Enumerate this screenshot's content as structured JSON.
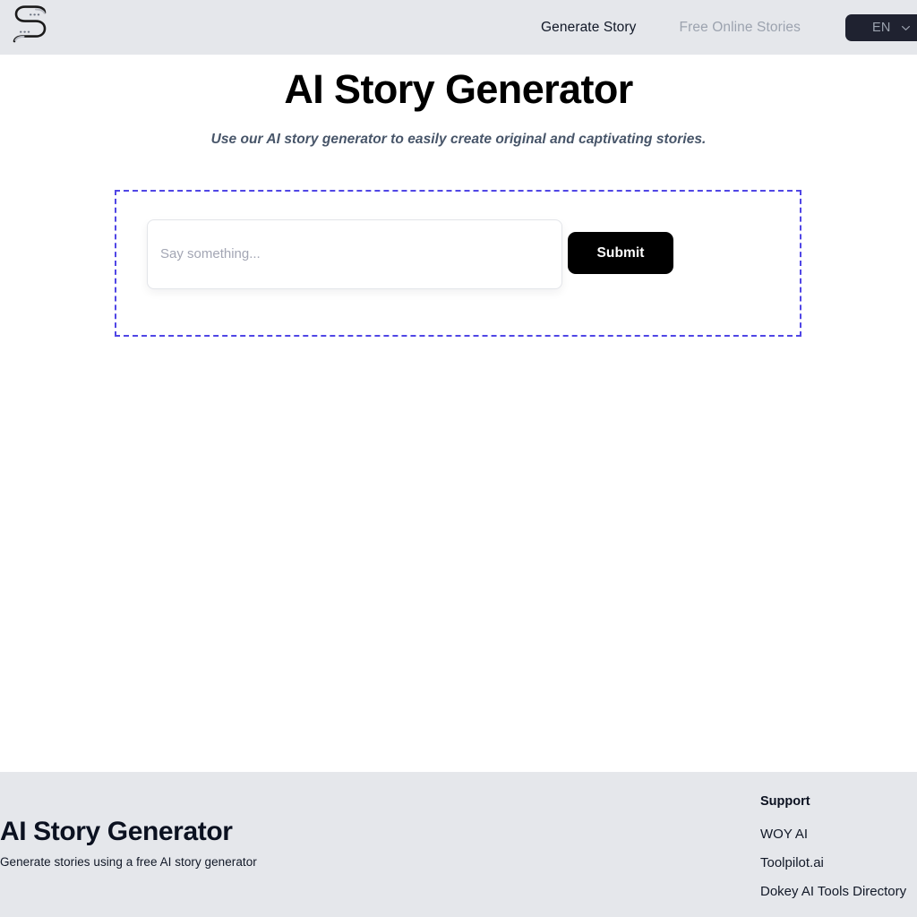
{
  "header": {
    "logo_icon": "serpentine-s-logo",
    "nav": [
      {
        "label": "Generate Story",
        "active": true
      },
      {
        "label": "Free Online Stories",
        "active": false
      }
    ],
    "language": {
      "label": "EN",
      "chevron_icon": "chevron-down-icon"
    },
    "background_color": "#e5e7eb"
  },
  "hero": {
    "title": "AI Story Generator",
    "subtitle": "Use our AI story generator to easily create original and captivating stories."
  },
  "form": {
    "border_color": "#5046e5",
    "input": {
      "value": "",
      "placeholder": "Say something..."
    },
    "submit_label": "Submit",
    "submit_color": "#000000"
  },
  "footer": {
    "title": "AI Story Generator",
    "tagline": "Generate stories using a free AI story generator",
    "support": {
      "heading": "Support",
      "links": [
        "WOY AI",
        "Toolpilot.ai",
        "Dokey AI Tools Directory"
      ]
    },
    "background_color": "#e5e7eb"
  }
}
